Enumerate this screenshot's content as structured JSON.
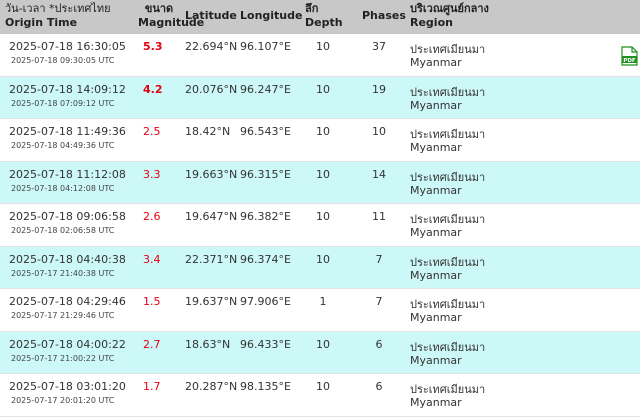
{
  "header": {
    "origin_time_th": "วัน-เวลา *ประเทศไทย",
    "origin_time_en": "Origin Time",
    "magnitude_th": "ขนาด",
    "magnitude_en": "Magnitude",
    "latitude": "Latitude",
    "longitude": "Longitude",
    "depth_th": "ลึก",
    "depth_en": "Depth",
    "phases": "Phases",
    "region_th": "บริเวณศูนย์กลาง",
    "region_en": "Region"
  },
  "pdf_icon_label": "PDF",
  "rows": [
    {
      "time": "2025-07-18 16:30:05",
      "utc": "2025-07-18 09:30:05 UTC",
      "mag": "5.3",
      "lat": "22.694°N",
      "lon": "96.107°E",
      "depth": "10",
      "phases": "37",
      "region_th": "ประเทศเมียนมา",
      "region_en": "Myanmar"
    },
    {
      "time": "2025-07-18 14:09:12",
      "utc": "2025-07-18 07:09:12 UTC",
      "mag": "4.2",
      "lat": "20.076°N",
      "lon": "96.247°E",
      "depth": "10",
      "phases": "19",
      "region_th": "ประเทศเมียนมา",
      "region_en": "Myanmar"
    },
    {
      "time": "2025-07-18 11:49:36",
      "utc": "2025-07-18 04:49:36 UTC",
      "mag": "2.5",
      "lat": "18.42°N",
      "lon": "96.543°E",
      "depth": "10",
      "phases": "10",
      "region_th": "ประเทศเมียนมา",
      "region_en": "Myanmar"
    },
    {
      "time": "2025-07-18 11:12:08",
      "utc": "2025-07-18 04:12:08 UTC",
      "mag": "3.3",
      "lat": "19.663°N",
      "lon": "96.315°E",
      "depth": "10",
      "phases": "14",
      "region_th": "ประเทศเมียนมา",
      "region_en": "Myanmar"
    },
    {
      "time": "2025-07-18 09:06:58",
      "utc": "2025-07-18 02:06:58 UTC",
      "mag": "2.6",
      "lat": "19.647°N",
      "lon": "96.382°E",
      "depth": "10",
      "phases": "11",
      "region_th": "ประเทศเมียนมา",
      "region_en": "Myanmar"
    },
    {
      "time": "2025-07-18 04:40:38",
      "utc": "2025-07-17 21:40:38 UTC",
      "mag": "3.4",
      "lat": "22.371°N",
      "lon": "96.374°E",
      "depth": "10",
      "phases": "7",
      "region_th": "ประเทศเมียนมา",
      "region_en": "Myanmar"
    },
    {
      "time": "2025-07-18 04:29:46",
      "utc": "2025-07-17 21:29:46 UTC",
      "mag": "1.5",
      "lat": "19.637°N",
      "lon": "97.906°E",
      "depth": "1",
      "phases": "7",
      "region_th": "ประเทศเมียนมา",
      "region_en": "Myanmar"
    },
    {
      "time": "2025-07-18 04:00:22",
      "utc": "2025-07-17 21:00:22 UTC",
      "mag": "2.7",
      "lat": "18.63°N",
      "lon": "96.433°E",
      "depth": "10",
      "phases": "6",
      "region_th": "ประเทศเมียนมา",
      "region_en": "Myanmar"
    },
    {
      "time": "2025-07-18 03:01:20",
      "utc": "2025-07-17 20:01:20 UTC",
      "mag": "1.7",
      "lat": "20.287°N",
      "lon": "98.135°E",
      "depth": "10",
      "phases": "6",
      "region_th": "ประเทศเมียนมา",
      "region_en": "Myanmar"
    }
  ],
  "colors": {
    "header_bg": "#c8c8c8",
    "alt_row_bg": "#cdf8f8",
    "magnitude": "#e3000f",
    "pdf_icon": "#1f8f1f"
  }
}
